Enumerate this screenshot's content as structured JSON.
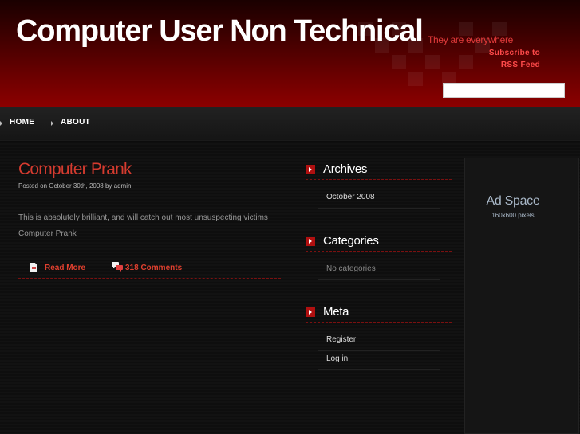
{
  "header": {
    "site_title": "Computer User Non Technical",
    "tagline": "They are everywhere",
    "subscribe_line1": "Subscribe to",
    "subscribe_line2": "RSS Feed",
    "search_value": ""
  },
  "nav": {
    "items": [
      {
        "label": "HOME"
      },
      {
        "label": "ABOUT"
      }
    ]
  },
  "post": {
    "title": "Computer Prank",
    "meta": "Posted on October 30th, 2008 by admin",
    "excerpt": "This is absolutely brilliant, and will catch out most unsuspecting victims",
    "link_text": "Computer Prank",
    "read_more": "Read More",
    "comments": "318 Comments"
  },
  "sidebar": {
    "archives": {
      "title": "Archives",
      "items": [
        "October 2008"
      ]
    },
    "categories": {
      "title": "Categories",
      "items": [
        "No categories"
      ]
    },
    "meta": {
      "title": "Meta",
      "items": [
        "Register",
        "Log in"
      ]
    }
  },
  "ad": {
    "title": "Ad Space",
    "subtitle": "160x600 pixels"
  },
  "colors": {
    "accent_red": "#d53b2f",
    "header_red": "#8c0000",
    "background": "#0c0c0c"
  }
}
